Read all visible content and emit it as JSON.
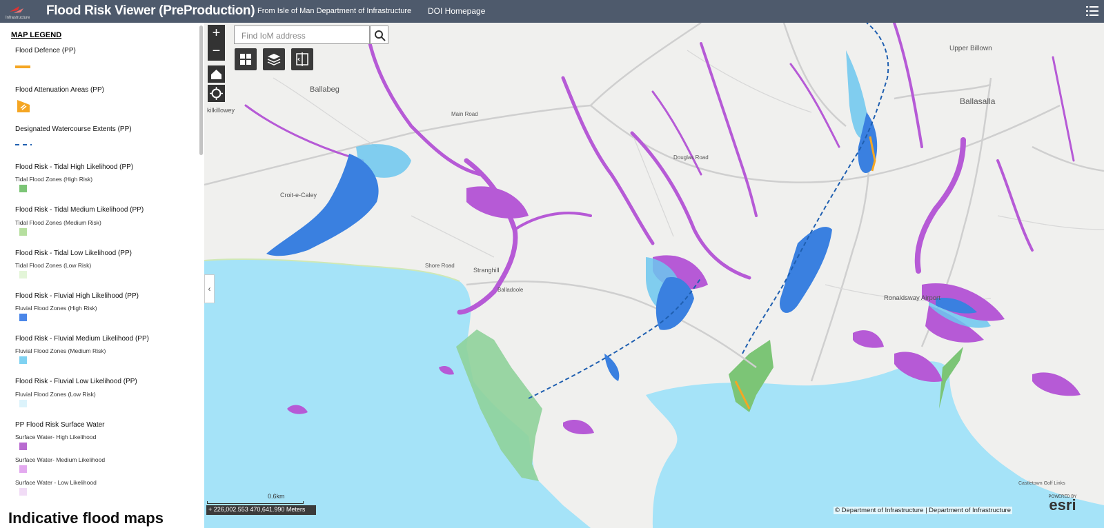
{
  "header": {
    "logo_text": "Infrastructure",
    "title": "Flood Risk Viewer (PreProduction)",
    "link_source": "From Isle of Man Department of Infrastructure",
    "link_home": "DOI Homepage"
  },
  "legend": {
    "title": "MAP LEGEND",
    "items": [
      {
        "layer": "Flood Defence (PP)",
        "color": "#f5a623"
      },
      {
        "layer": "Flood Attenuation Areas (PP)",
        "color": "#f5a623"
      },
      {
        "layer": "Designated Watercourse Extents (PP)",
        "color": "#1f5fb0"
      },
      {
        "layer": "Flood Risk - Tidal High Likelihood (PP)",
        "sub": "Tidal Flood Zones (High Risk)",
        "color": "#7cc576"
      },
      {
        "layer": "Flood Risk - Tidal Medium Likelihood (PP)",
        "sub": "Tidal Flood Zones (Medium Risk)",
        "color": "#b6df9f"
      },
      {
        "layer": "Flood Risk - Tidal Low Likelihood (PP)",
        "sub": "Tidal Flood Zones (Low Risk)",
        "color": "#e3f5d8"
      },
      {
        "layer": "Flood Risk - Fluvial High Likelihood (PP)",
        "sub": "Fluvial Flood Zones (High Risk)",
        "color": "#4a86e8"
      },
      {
        "layer": "Flood Risk - Fluvial Medium Likelihood (PP)",
        "sub": "Fluvial Flood Zones (Medium Risk)",
        "color": "#7fd2f2"
      },
      {
        "layer": "Flood Risk - Fluvial Low Likelihood (PP)",
        "sub": "Fluvial Flood Zones (Low Risk)",
        "color": "#dcf3fb"
      },
      {
        "layer": "PP Flood Risk Surface Water"
      }
    ],
    "surface_water": [
      {
        "label": "Surface Water- High Likelihood",
        "color": "#b86bd0"
      },
      {
        "label": "Surface Water- Medium Likelihood",
        "color": "#e3a9ef"
      },
      {
        "label": "Surface Water - Low Likelihood",
        "color": "#f1dcf6"
      }
    ],
    "next_section": "Indicative flood maps"
  },
  "map": {
    "search_placeholder": "Find IoM address",
    "zoom_in": "+",
    "zoom_out": "−",
    "scale_label": "0.6km",
    "coordinates": "226,002.553 470,641.990 Meters",
    "attribution": "© Department of Infrastructure | Department of Infrastructure",
    "esri_powered": "POWERED BY",
    "esri_logo": "esri",
    "place_labels": [
      "Upper Billown",
      "Ballabeg",
      "Ballasalla",
      "Croit-e-Caley",
      "Stranghill",
      "Ronaldsway Airport",
      "Balladoole",
      "Douglas Road",
      "Shore Road",
      "Main Road",
      "kilkillowey",
      "Castletown Golf Links"
    ],
    "colors": {
      "sea": "#a5e3f8",
      "land": "#f0f0ee",
      "surface_high": "#b65ad6",
      "fluvial_high": "#3a80e0",
      "fluvial_med": "#6cc7ef",
      "tidal": "#8fd19a",
      "defence": "#f5a623"
    }
  }
}
